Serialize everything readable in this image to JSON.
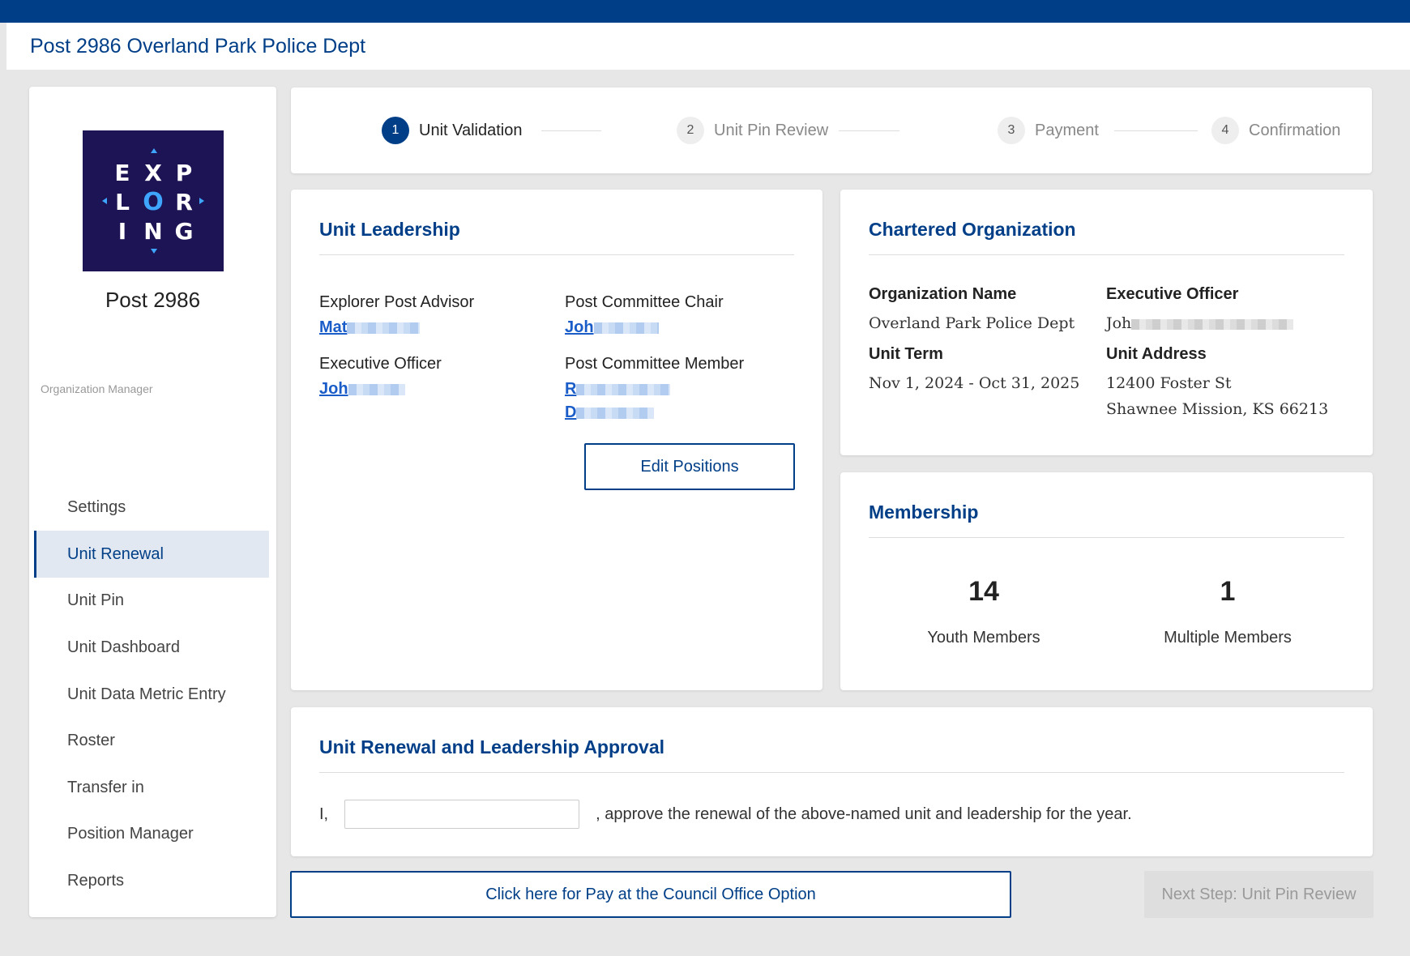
{
  "header": {
    "title": "Post 2986 Overland Park Police Dept"
  },
  "colors": {
    "brand": "#003f87",
    "logo_bg": "#1c1454",
    "logo_accent": "#3ea6ff",
    "link": "#1a5dc8"
  },
  "sidebar": {
    "logo": {
      "letters": [
        "E",
        "X",
        "P",
        "L",
        "O",
        "R",
        "I",
        "N",
        "G"
      ]
    },
    "post_name": "Post 2986",
    "section_label": "Organization Manager",
    "items": [
      {
        "label": "Settings",
        "active": false
      },
      {
        "label": "Unit Renewal",
        "active": true
      },
      {
        "label": "Unit Pin",
        "active": false
      },
      {
        "label": "Unit Dashboard",
        "active": false
      },
      {
        "label": "Unit Data Metric Entry",
        "active": false
      },
      {
        "label": "Roster",
        "active": false
      },
      {
        "label": "Transfer in",
        "active": false
      },
      {
        "label": "Position Manager",
        "active": false
      },
      {
        "label": "Reports",
        "active": false
      }
    ]
  },
  "stepper": {
    "steps": [
      {
        "number": "1",
        "label": "Unit Validation",
        "active": true
      },
      {
        "number": "2",
        "label": "Unit Pin Review",
        "active": false
      },
      {
        "number": "3",
        "label": "Payment",
        "active": false
      },
      {
        "number": "4",
        "label": "Confirmation",
        "active": false
      }
    ]
  },
  "leadership": {
    "title": "Unit Leadership",
    "advisor": {
      "title": "Explorer Post Advisor",
      "name": "Mat"
    },
    "chair": {
      "title": "Post Committee Chair",
      "name": "Joh"
    },
    "exec_officer": {
      "title": "Executive Officer",
      "name": "Joh"
    },
    "committee_member": {
      "title": "Post Committee Member",
      "names": [
        "R",
        "D"
      ]
    },
    "edit_button": "Edit Positions"
  },
  "chartered": {
    "title": "Chartered Organization",
    "org_name_label": "Organization Name",
    "org_name": "Overland Park Police Dept",
    "exec_label": "Executive Officer",
    "exec_name": "Joh",
    "term_label": "Unit Term",
    "term": "Nov 1, 2024 - Oct 31, 2025",
    "address_label": "Unit Address",
    "address_line1": "12400 Foster St",
    "address_line2": "Shawnee Mission, KS 66213"
  },
  "membership": {
    "title": "Membership",
    "youth_count": "14",
    "youth_label": "Youth Members",
    "multiple_count": "1",
    "multiple_label": "Multiple Members"
  },
  "approval": {
    "title": "Unit Renewal and Leadership Approval",
    "prefix": "I,",
    "input_value": "",
    "suffix": ", approve the renewal of the above-named unit and leadership for the year."
  },
  "actions": {
    "council_button": "Click here for Pay at the Council Office Option",
    "next_button": "Next Step: Unit Pin Review"
  }
}
